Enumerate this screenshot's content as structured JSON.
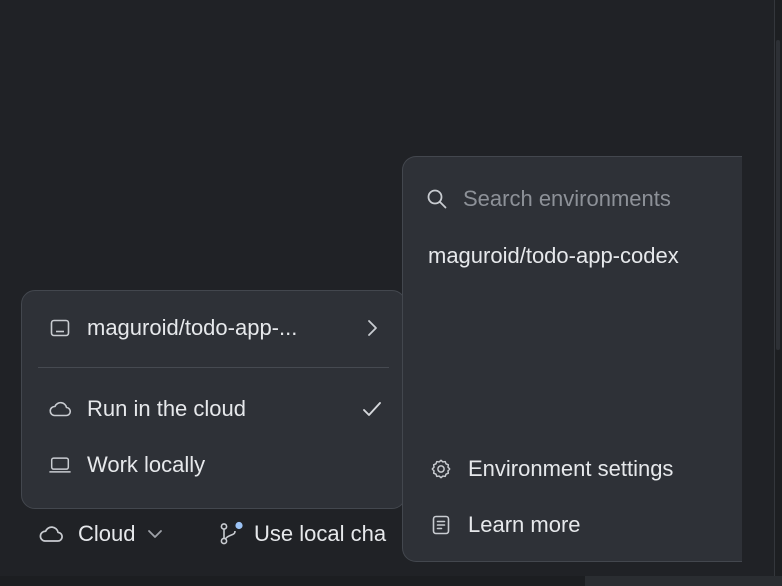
{
  "menu": {
    "repo_label": "maguroid/todo-app-...",
    "run_cloud_label": "Run in the cloud",
    "work_locally_label": "Work locally"
  },
  "env_panel": {
    "search_placeholder": "Search environments",
    "environment_item": "maguroid/todo-app-codex",
    "settings_label": "Environment settings",
    "learn_more_label": "Learn more"
  },
  "toolbar": {
    "cloud_label": "Cloud",
    "local_changes_label": "Use local cha"
  },
  "colors": {
    "background": "#202226",
    "popover": "#2e3137",
    "text": "#e6e8eb",
    "muted": "#8d9198",
    "badge": "#9cc3f5"
  },
  "icons": {
    "repo": "laptop-screen-icon",
    "submenu": "chevron-right-icon",
    "cloud": "cloud-icon",
    "check": "check-icon",
    "local": "laptop-icon",
    "search": "search-icon",
    "settings": "gear-icon",
    "learn": "document-icon",
    "dropdown": "chevron-down-icon",
    "branch": "git-branch-icon"
  }
}
